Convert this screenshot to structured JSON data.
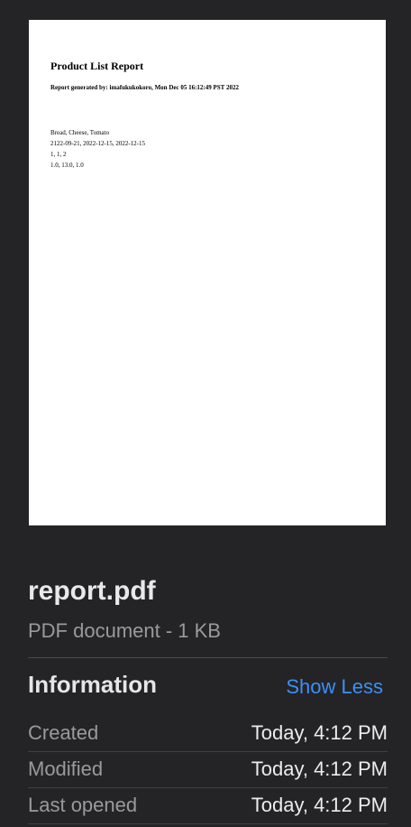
{
  "preview": {
    "title": "Product List Report",
    "subtitle": "Report generated by: imafukukokoro, Mon Dec 05 16:12:49 PST 2022",
    "lines": [
      "Bread, Cheese, Tomato",
      "2122-09-21, 2022-12-15, 2022-12-15",
      "1, 1, 2",
      "1.0, 13.0, 1.0"
    ]
  },
  "file": {
    "name": "report.pdf",
    "kind": "PDF document - 1 KB"
  },
  "info": {
    "heading": "Information",
    "toggle_label": "Show Less",
    "rows": [
      {
        "label": "Created",
        "value": "Today, 4:12 PM"
      },
      {
        "label": "Modified",
        "value": "Today, 4:12 PM"
      },
      {
        "label": "Last opened",
        "value": "Today, 4:12 PM"
      }
    ]
  },
  "colors": {
    "background": "#242426",
    "accent": "#3d8ff5",
    "secondary_text": "#9a9a9c"
  }
}
